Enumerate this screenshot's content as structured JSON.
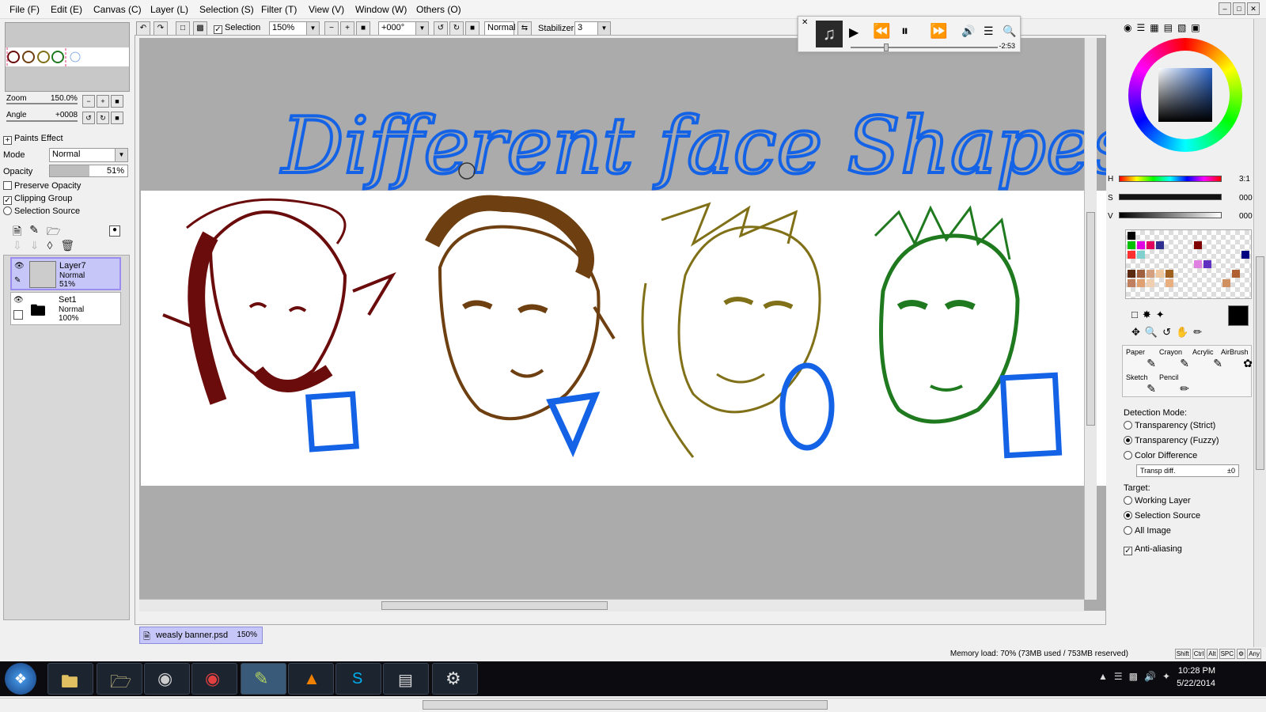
{
  "menu": {
    "items": [
      "File (F)",
      "Edit (E)",
      "Canvas (C)",
      "Layer (L)",
      "Selection (S)",
      "Filter (T)",
      "View (V)",
      "Window (W)",
      "Others (O)"
    ]
  },
  "toolbar": {
    "selection_label": "Selection",
    "zoom": "150%",
    "angle": "+000°",
    "blend": "Normal",
    "stabilizer_label": "Stabilizer",
    "stabilizer": "3"
  },
  "navigator": {
    "zoom_label": "Zoom",
    "zoom_value": "150.0%",
    "angle_label": "Angle",
    "angle_value": "+0008"
  },
  "layer_panel": {
    "paints_effect": "Paints Effect",
    "mode_label": "Mode",
    "mode_value": "Normal",
    "opacity_label": "Opacity",
    "opacity_value": "51%",
    "opacity_fraction": 0.51,
    "preserve_opacity": "Preserve Opacity",
    "clipping_group": "Clipping Group",
    "selection_source": "Selection Source",
    "layers": [
      {
        "name": "Layer7",
        "mode": "Normal",
        "opacity": "51%"
      },
      {
        "name": "Set1",
        "mode": "Normal",
        "opacity": "100%"
      }
    ]
  },
  "canvas": {
    "banner_text": "Different face Shapes",
    "document_tab": "weasly banner.psd",
    "document_zoom": "150%"
  },
  "player": {
    "time": "-2:53"
  },
  "color_panel": {
    "h_label": "H",
    "s_label": "S",
    "v_label": "V",
    "h_value": "3:1",
    "s_value": "000",
    "v_value": "000"
  },
  "tools": {
    "brushes": [
      "Paper",
      "Crayon",
      "Acrylic",
      "AirBrush",
      "Sketch",
      "Pencil"
    ],
    "detection_mode_label": "Detection Mode:",
    "detection_modes": [
      "Transparency (Strict)",
      "Transparency (Fuzzy)",
      "Color Difference"
    ],
    "transp_diff_label": "Transp diff.",
    "transp_diff_value": "±0",
    "target_label": "Target:",
    "targets": [
      "Working Layer",
      "Selection Source",
      "All Image"
    ],
    "anti_aliasing": "Anti-aliasing"
  },
  "status": {
    "memory": "Memory load: 70% (73MB used / 753MB reserved)",
    "keys": [
      "Shift",
      "Ctrl",
      "Alt",
      "SPC",
      "Any"
    ]
  },
  "taskbar": {
    "time": "10:28 PM",
    "date": "5/22/2014"
  },
  "colors": {
    "banner_blue": "#1463e6",
    "face1": "#6b0c0c",
    "face2": "#6e3f10",
    "face3": "#807018",
    "face4": "#1f7a1f",
    "selected_layer": "#c6c6f8"
  }
}
